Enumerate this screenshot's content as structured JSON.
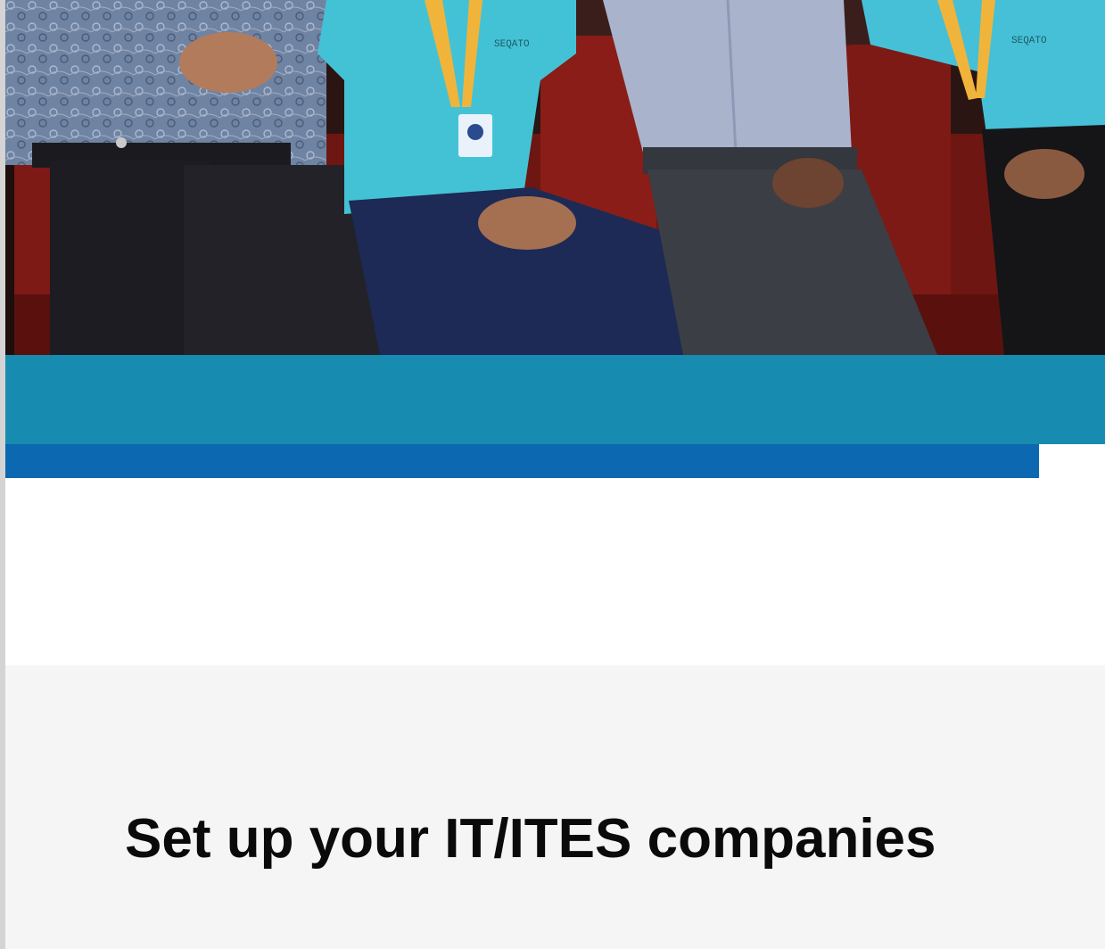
{
  "hero": {
    "image": "team-seated-on-sofa-photo",
    "shirt_print": "SEQATO"
  },
  "colors": {
    "teal_band": "#178bb0",
    "blue_strip": "#0c68b0",
    "section_bg": "#f5f5f5",
    "headline_text": "#0a0a0a"
  },
  "section": {
    "headline": "Set up your IT/ITES companies"
  }
}
